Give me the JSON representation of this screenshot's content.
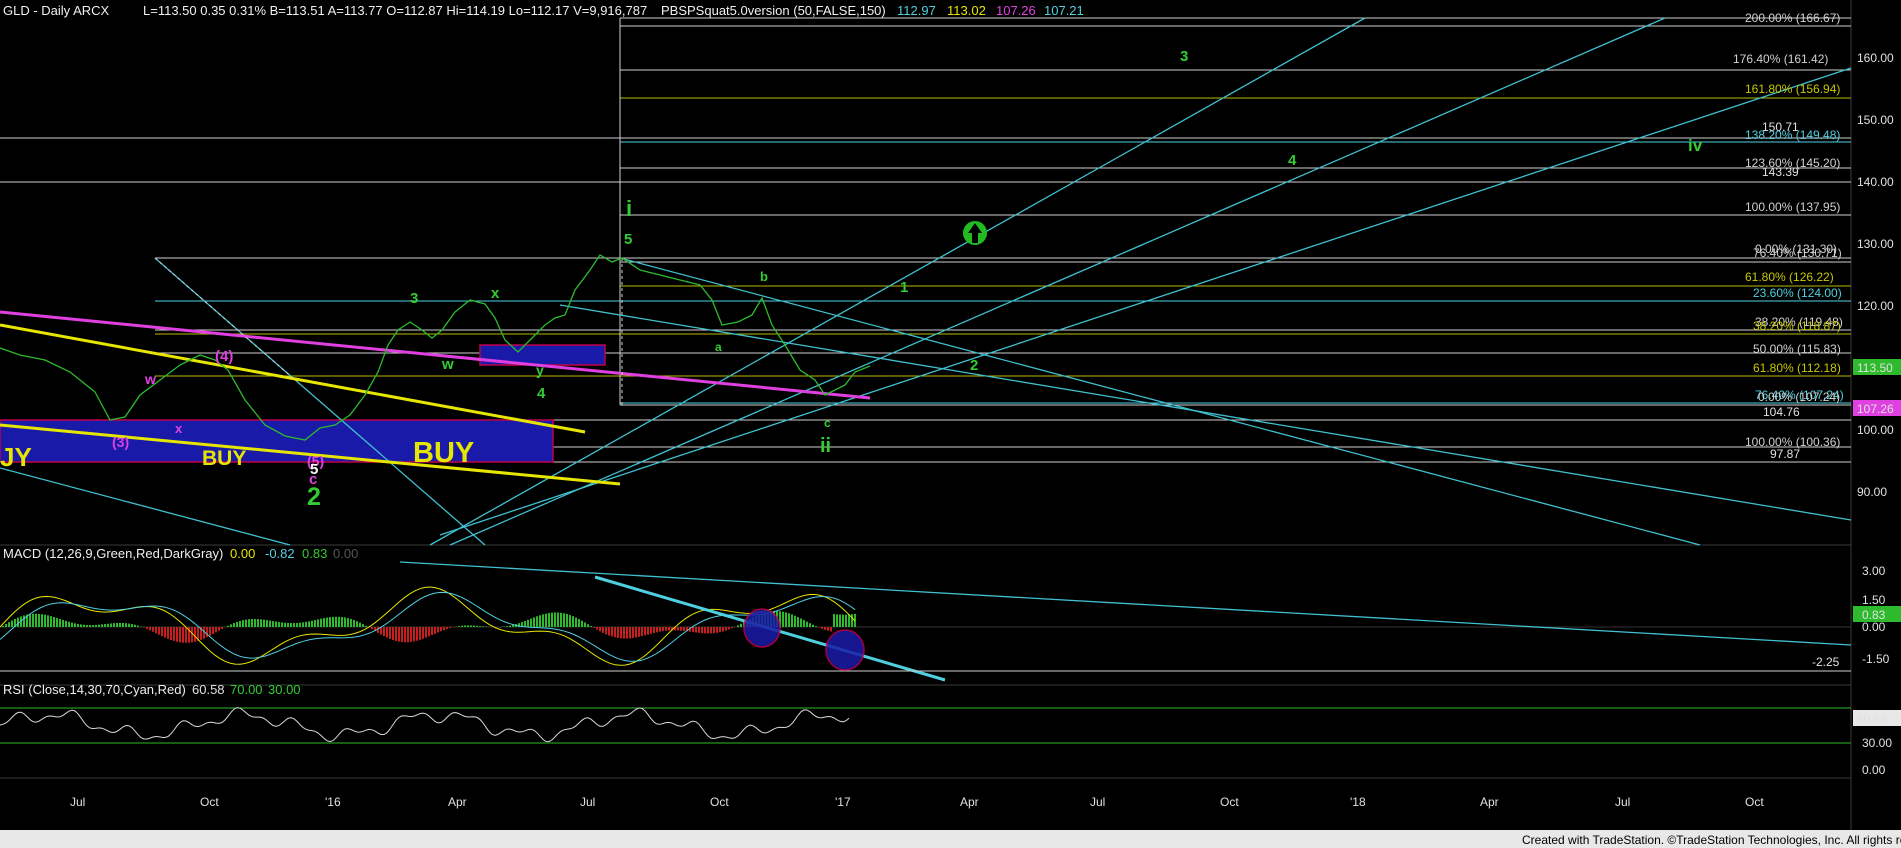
{
  "header": {
    "symbol_text": "GLD - Daily  ARCX",
    "quote_text": "L=113.50  0.35  0.31%  B=113.51  A=113.77  O=112.87  Hi=114.19  Lo=112.17  V=9,916,787",
    "indicator_name": "PBSPSquat5.0version (50,FALSE,150)",
    "indicator_values": [
      {
        "text": "112.97",
        "color": "#4fd0e0"
      },
      {
        "text": "113.02",
        "color": "#e6e600"
      },
      {
        "text": "107.26",
        "color": "#e040e0"
      },
      {
        "text": "107.21",
        "color": "#4fd0e0"
      }
    ]
  },
  "price_axis": {
    "ticks": [
      "160.00",
      "150.00",
      "140.00",
      "130.00",
      "120.00",
      "110.00",
      "100.00",
      "90.00"
    ],
    "last_price": "113.50",
    "magenta_price": "107.26"
  },
  "fib_labels": [
    {
      "text": "200.00% (166.67)",
      "color": "#d0d0d0"
    },
    {
      "text": "176.40% (161.42)",
      "color": "#d0d0d0"
    },
    {
      "text": "161.80% (156.94)",
      "color": "#c8c800"
    },
    {
      "text": "150.71",
      "color": "#e0e0e0"
    },
    {
      "text": "138.20% (149.48)",
      "color": "#4fd0e0"
    },
    {
      "text": "123.60% (145.20)",
      "color": "#d0d0d0"
    },
    {
      "text": "143.39",
      "color": "#e0e0e0"
    },
    {
      "text": "100.00% (137.95)",
      "color": "#d0d0d0"
    },
    {
      "text": "0.00% (131.30)",
      "color": "#d0d0d0"
    },
    {
      "text": "76.40% (130.71)",
      "color": "#d0d0d0"
    },
    {
      "text": "61.80% (126.22)",
      "color": "#c8c800"
    },
    {
      "text": "23.60% (124.00)",
      "color": "#4fd0e0"
    },
    {
      "text": "38.20% (119.48)",
      "color": "#d0d0d0"
    },
    {
      "text": "38.20% (118.87)",
      "color": "#c8c800"
    },
    {
      "text": "50.00% (115.83)",
      "color": "#d0d0d0"
    },
    {
      "text": "61.80% (112.18)",
      "color": "#c8c800"
    },
    {
      "text": "76.40% (107.24)",
      "color": "#4fd0e0"
    },
    {
      "text": "0.00% (107.24)",
      "color": "#d0d0d0"
    },
    {
      "text": "104.76",
      "color": "#e0e0e0"
    },
    {
      "text": "100.00% (100.36)",
      "color": "#d0d0d0"
    },
    {
      "text": "97.87",
      "color": "#e0e0e0"
    }
  ],
  "wave_labels": [
    {
      "text": "3",
      "color": "#33cc33"
    },
    {
      "text": "4",
      "color": "#33cc33"
    },
    {
      "text": "iv",
      "color": "#33cc33"
    },
    {
      "text": "i",
      "color": "#33cc33"
    },
    {
      "text": "5",
      "color": "#33cc33"
    },
    {
      "text": "b",
      "color": "#33cc33"
    },
    {
      "text": "1",
      "color": "#33cc33"
    },
    {
      "text": "2",
      "color": "#33cc33"
    },
    {
      "text": "a",
      "color": "#33cc33"
    },
    {
      "text": "c",
      "color": "#33cc33"
    },
    {
      "text": "ii",
      "color": "#33cc33"
    },
    {
      "text": "3",
      "color": "#33cc33"
    },
    {
      "text": "x",
      "color": "#33cc33"
    },
    {
      "text": "w",
      "color": "#33cc33"
    },
    {
      "text": "y",
      "color": "#33cc33"
    },
    {
      "text": "4",
      "color": "#33cc33"
    },
    {
      "text": "(4)",
      "color": "#e040e0"
    },
    {
      "text": "w",
      "color": "#e040e0"
    },
    {
      "text": "x",
      "color": "#e040e0"
    },
    {
      "text": "(3)",
      "color": "#e040e0"
    },
    {
      "text": "(5)",
      "color": "#e040e0"
    },
    {
      "text": "5",
      "color": "#ffffff"
    },
    {
      "text": "c",
      "color": "#e040e0"
    },
    {
      "text": "2",
      "color": "#33cc33"
    }
  ],
  "buy_labels": [
    "JY",
    "BUY",
    "BUY"
  ],
  "macd": {
    "title": "MACD (12,26,9,Green,Red,DarkGray)",
    "values": [
      {
        "text": "0.00",
        "color": "#e6e600"
      },
      {
        "text": "-0.82",
        "color": "#4fd0e0"
      },
      {
        "text": "0.83",
        "color": "#33cc33"
      },
      {
        "text": "0.00",
        "color": "#555555"
      }
    ],
    "ticks": [
      "3.00",
      "1.50",
      "0.00",
      "-1.50"
    ],
    "current": "0.83",
    "line_label": "-2.25"
  },
  "rsi": {
    "title": "RSI (Close,14,30,70,Cyan,Red)",
    "values": [
      {
        "text": "60.58",
        "color": "#e0e0e0"
      },
      {
        "text": "70.00",
        "color": "#33cc33"
      },
      {
        "text": "30.00",
        "color": "#33cc33"
      }
    ],
    "ticks": [
      "30.00",
      "0.00"
    ],
    "current": "60.58"
  },
  "x_axis": {
    "labels": [
      "Jul",
      "Oct",
      "'16",
      "Apr",
      "Jul",
      "Oct",
      "'17",
      "Apr",
      "Jul",
      "Oct",
      "'18",
      "Apr",
      "Jul",
      "Oct"
    ]
  },
  "footer": "Created with TradeStation. ©TradeStation Technologies, Inc. All rights reserved.",
  "chart_data": {
    "type": "line",
    "title": "GLD - Daily",
    "x": [
      "Jul",
      "Oct",
      "'16",
      "Apr",
      "Jul",
      "Oct",
      "'17"
    ],
    "series": [
      {
        "name": "GLD",
        "values": [
          112,
          108,
          101,
          119,
          131,
          120,
          113.5
        ]
      }
    ],
    "ylim": [
      85,
      168
    ]
  }
}
